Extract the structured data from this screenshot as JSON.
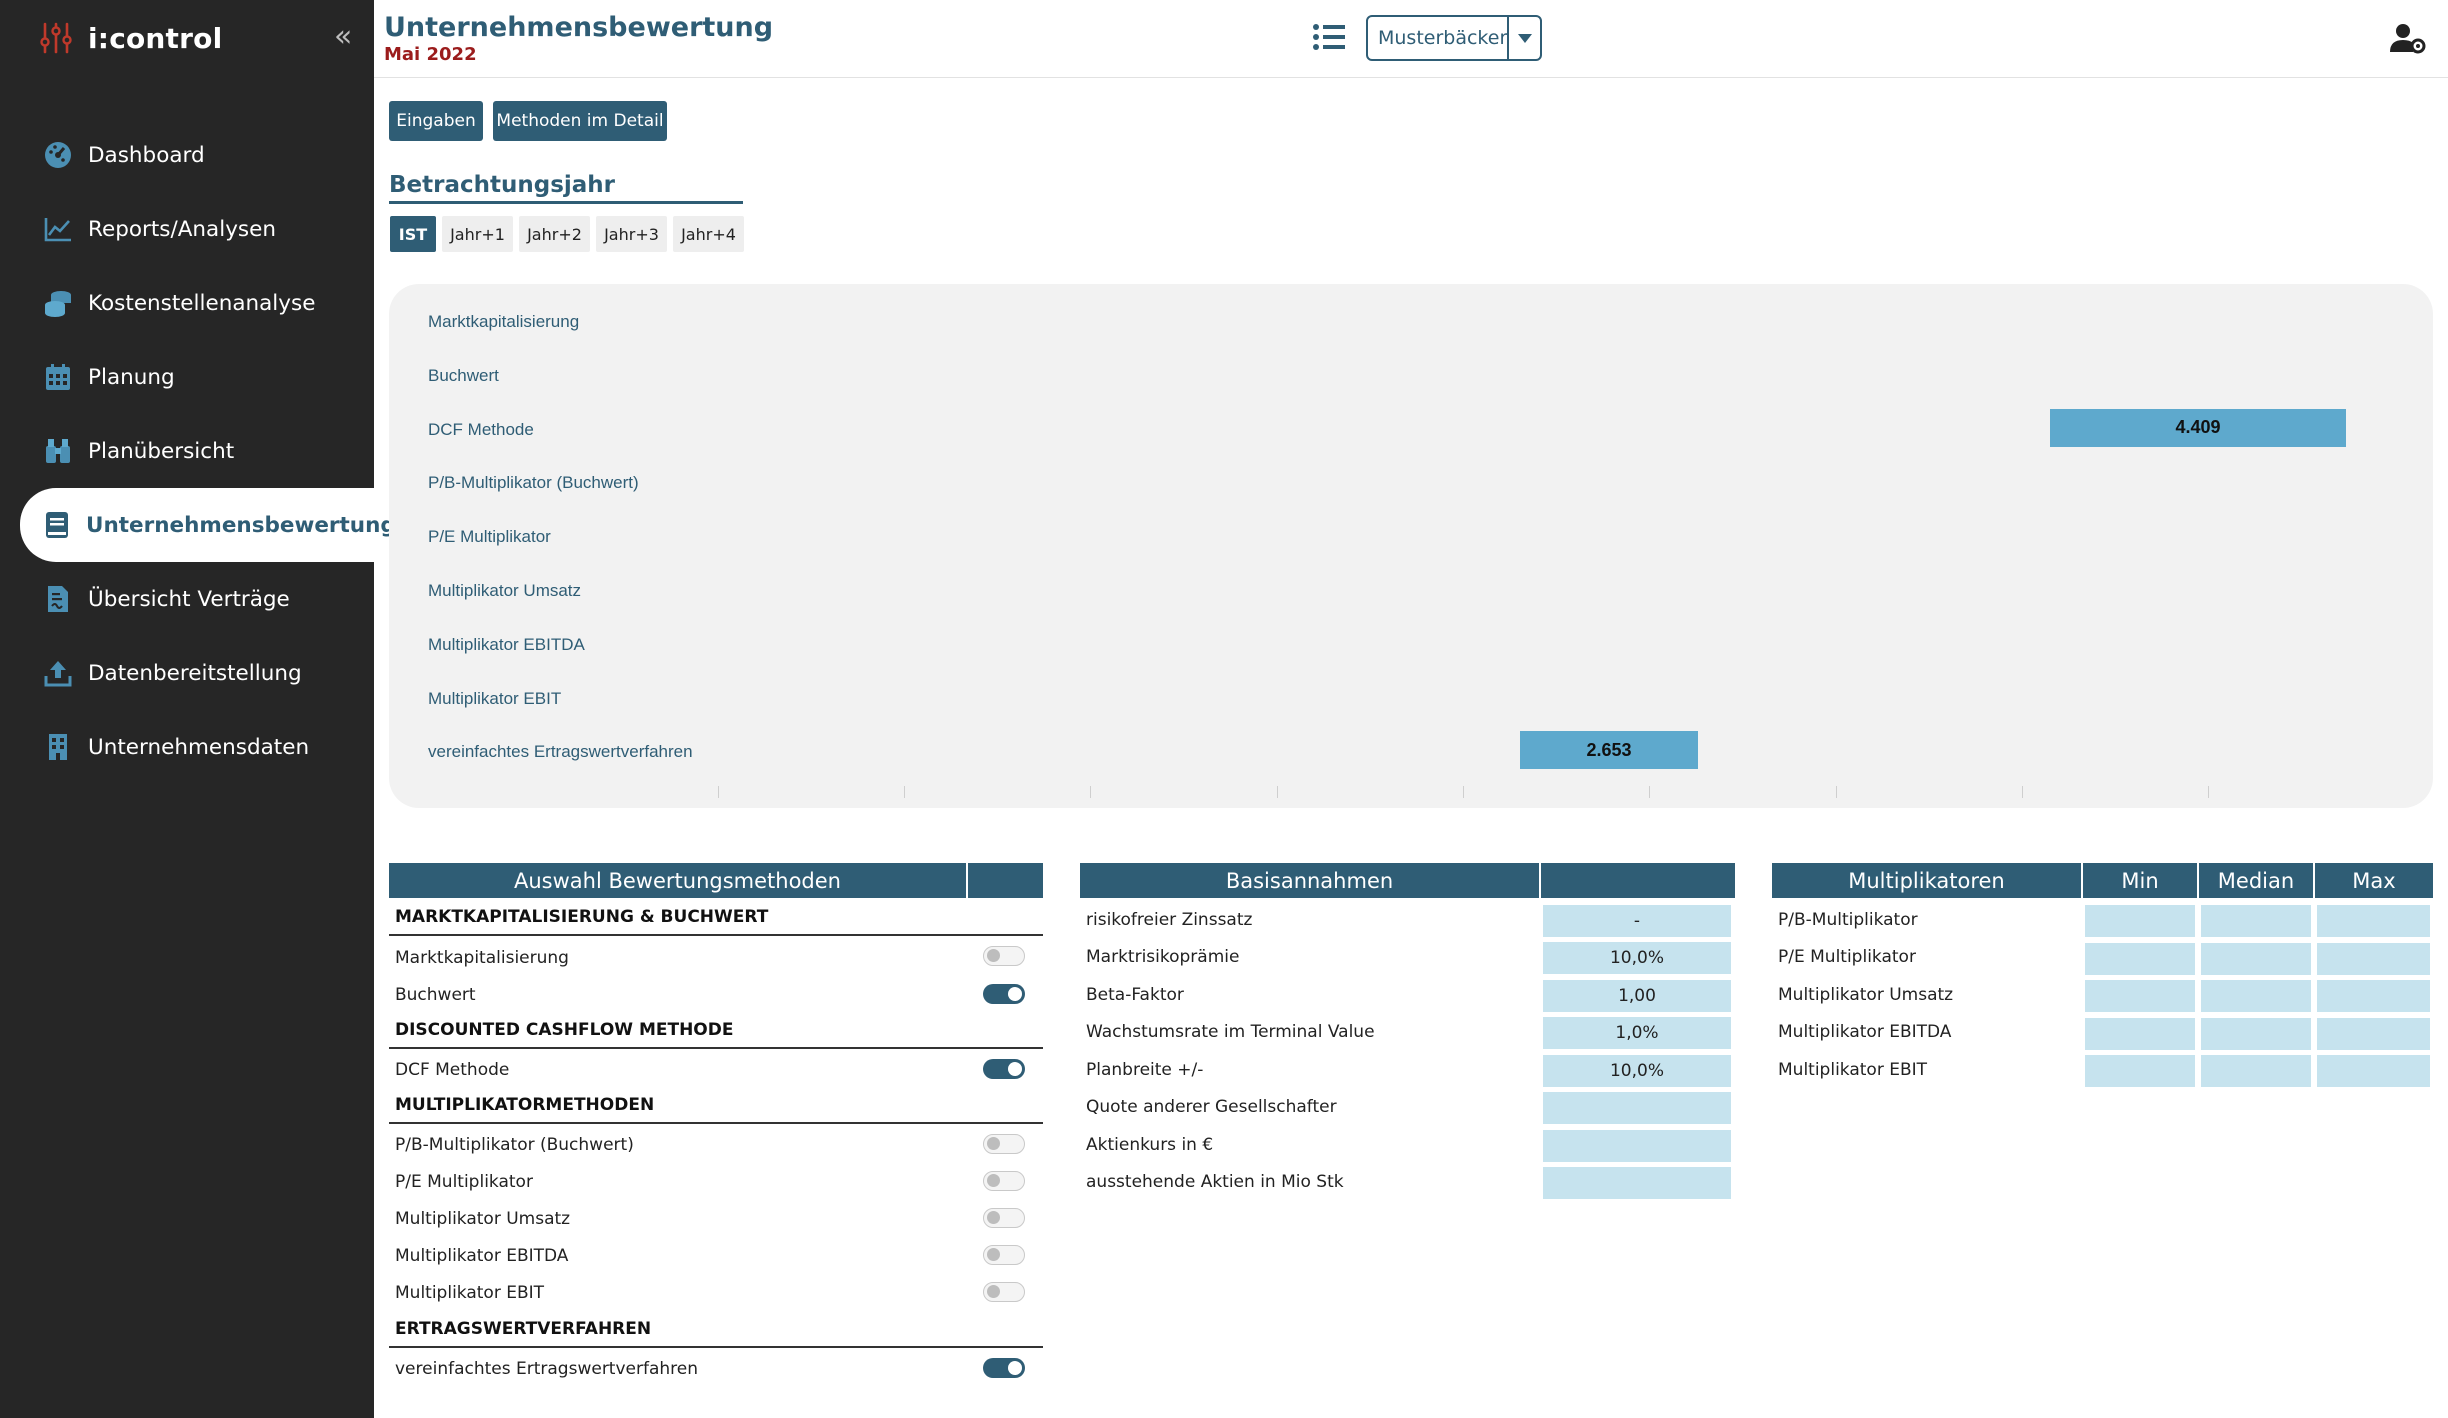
{
  "app": {
    "name": "i:control",
    "collapse_glyph": "«"
  },
  "sidebar": {
    "items": [
      {
        "label": "Dashboard",
        "icon": "dashboard-gauge-icon"
      },
      {
        "label": "Reports/Analysen",
        "icon": "line-chart-icon"
      },
      {
        "label": "Kostenstellenanalyse",
        "icon": "coins-icon"
      },
      {
        "label": "Planung",
        "icon": "calendar-icon"
      },
      {
        "label": "Planübersicht",
        "icon": "binoculars-icon"
      },
      {
        "label": "Unternehmensbewertung",
        "icon": "book-icon",
        "active": true
      },
      {
        "label": "Übersicht Verträge",
        "icon": "contract-icon"
      },
      {
        "label": "Datenbereitstellung",
        "icon": "upload-icon"
      },
      {
        "label": "Unternehmensdaten",
        "icon": "building-icon"
      }
    ]
  },
  "header": {
    "title": "Unternehmensbewertung",
    "subtitle": "Mai 2022",
    "company": "Musterbäcker"
  },
  "toolbar": {
    "eingaben": "Eingaben",
    "methoden": "Methoden im Detail"
  },
  "year_section": {
    "title": "Betrachtungsjahr",
    "tabs": [
      "IST",
      "Jahr+1",
      "Jahr+2",
      "Jahr+3",
      "Jahr+4"
    ],
    "active": "IST"
  },
  "chart_data": {
    "type": "bar",
    "orientation": "horizontal",
    "categories": [
      "Marktkapitalisierung",
      "Buchwert",
      "DCF Methode",
      "P/B-Multiplikator (Buchwert)",
      "P/E Multiplikator",
      "Multiplikator Umsatz",
      "Multiplikator EBITDA",
      "Multiplikator EBIT",
      "vereinfachtes Ertragswertverfahren"
    ],
    "value_labels": [
      "",
      "",
      "4.409",
      "",
      "",
      "",
      "",
      "",
      "2.653"
    ],
    "grid": false,
    "bar_color": "#5ea9cd"
  },
  "methods_table": {
    "header": "Auswahl Bewertungsmethoden",
    "sections": [
      {
        "title": "MARKTKAPITALISIERUNG & BUCHWERT",
        "rows": [
          {
            "label": "Marktkapitalisierung",
            "enabled": false
          },
          {
            "label": "Buchwert",
            "enabled": true
          }
        ]
      },
      {
        "title": "DISCOUNTED CASHFLOW METHODE",
        "rows": [
          {
            "label": "DCF Methode",
            "enabled": true
          }
        ]
      },
      {
        "title": "MULTIPLIKATORMETHODEN",
        "rows": [
          {
            "label": "P/B-Multiplikator (Buchwert)",
            "enabled": false
          },
          {
            "label": "P/E Multiplikator",
            "enabled": false
          },
          {
            "label": "Multiplikator Umsatz",
            "enabled": false
          },
          {
            "label": "Multiplikator EBITDA",
            "enabled": false
          },
          {
            "label": "Multiplikator EBIT",
            "enabled": false
          }
        ]
      },
      {
        "title": "ERTRAGSWERTVERFAHREN",
        "rows": [
          {
            "label": "vereinfachtes Ertragswertverfahren",
            "enabled": true
          }
        ]
      }
    ]
  },
  "basis_table": {
    "header": "Basisannahmen",
    "rows": [
      {
        "label": "risikofreier Zinssatz",
        "value": "-"
      },
      {
        "label": "Marktrisikoprämie",
        "value": "10,0%"
      },
      {
        "label": "Beta-Faktor",
        "value": "1,00"
      },
      {
        "label": "Wachstumsrate im Terminal Value",
        "value": "1,0%"
      },
      {
        "label": "Planbreite +/-",
        "value": "10,0%"
      },
      {
        "label": "Quote anderer Gesellschafter",
        "value": ""
      },
      {
        "label": "Aktienkurs in €",
        "value": ""
      },
      {
        "label": "ausstehende Aktien in Mio Stk",
        "value": ""
      }
    ]
  },
  "multi_table": {
    "header": "Multiplikatoren",
    "columns": [
      "Min",
      "Median",
      "Max"
    ],
    "rows": [
      "P/B-Multiplikator",
      "P/E Multiplikator",
      "Multiplikator Umsatz",
      "Multiplikator EBITDA",
      "Multiplikator EBIT"
    ]
  },
  "colors": {
    "primary": "#2f5d75",
    "sidebar_bg": "#262626",
    "subtitle_red": "#9b1c1c",
    "bar": "#5ea9cd",
    "input_cell": "#c6e3ee"
  }
}
